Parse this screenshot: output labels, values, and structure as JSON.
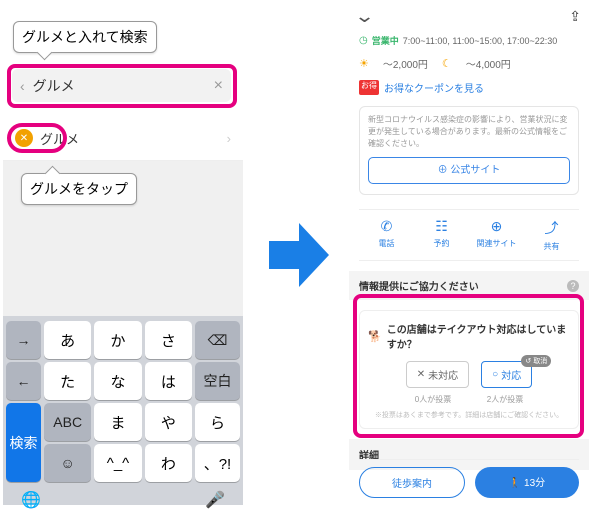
{
  "arrow": {
    "color": "#1a7fe6"
  },
  "left": {
    "callout_search": "グルメと入れて検索",
    "callout_tap": "グルメをタップ",
    "search": {
      "placeholder": "",
      "value": "グルメ",
      "back_label": "‹",
      "clear_label": "×"
    },
    "category": {
      "icon_name": "fork-knife-icon",
      "label": "グルメ",
      "chevron": "›"
    },
    "keyboard": {
      "rows": [
        [
          "→",
          "あ",
          "か",
          "さ",
          "⌫"
        ],
        [
          "←",
          "た",
          "な",
          "は",
          "空白"
        ],
        [
          "ABC",
          "ま",
          "や",
          "ら",
          "検索"
        ],
        [
          "☺",
          "\"",
          "わ",
          "、?!",
          ""
        ]
      ],
      "row4_accent": "^_^",
      "globe": "🌐",
      "mic": "🎤"
    }
  },
  "right": {
    "header": {
      "collapse": "⌄",
      "share": "⇪"
    },
    "hours": {
      "label": "営業中",
      "times": "7:00~11:00, 11:00~15:00, 17:00~22:30"
    },
    "price": {
      "day": "～2,000円",
      "night": "～4,000円"
    },
    "coupon": {
      "badge": "お得",
      "text": "お得なクーポンを見る"
    },
    "notice": "新型コロナウイルス感染症の影響により、営業状況に変更が発生している場合があります。最新の公式情報をご確認ください。",
    "official_site_btn": "公式サイト",
    "actions": [
      {
        "icon": "phone-icon",
        "label": "電話"
      },
      {
        "icon": "calendar-icon",
        "label": "予約"
      },
      {
        "icon": "globe-icon",
        "label": "関連サイト"
      },
      {
        "icon": "share-icon",
        "label": "共有"
      }
    ],
    "coop_header": "情報提供にご協力ください",
    "poll": {
      "question": "この店舗はテイクアウト対応はしていますか？",
      "opt_no": "未対応",
      "opt_yes": "対応",
      "vote_no": "0人が投票",
      "vote_yes": "2人が投票",
      "note": "※投票はあくまで参考です。詳細は店舗にご確認ください。",
      "chip": "↺ 取消"
    },
    "detail_header": "詳細",
    "bottom": {
      "walk": "徒歩案内",
      "time": "🚶 13分"
    }
  }
}
